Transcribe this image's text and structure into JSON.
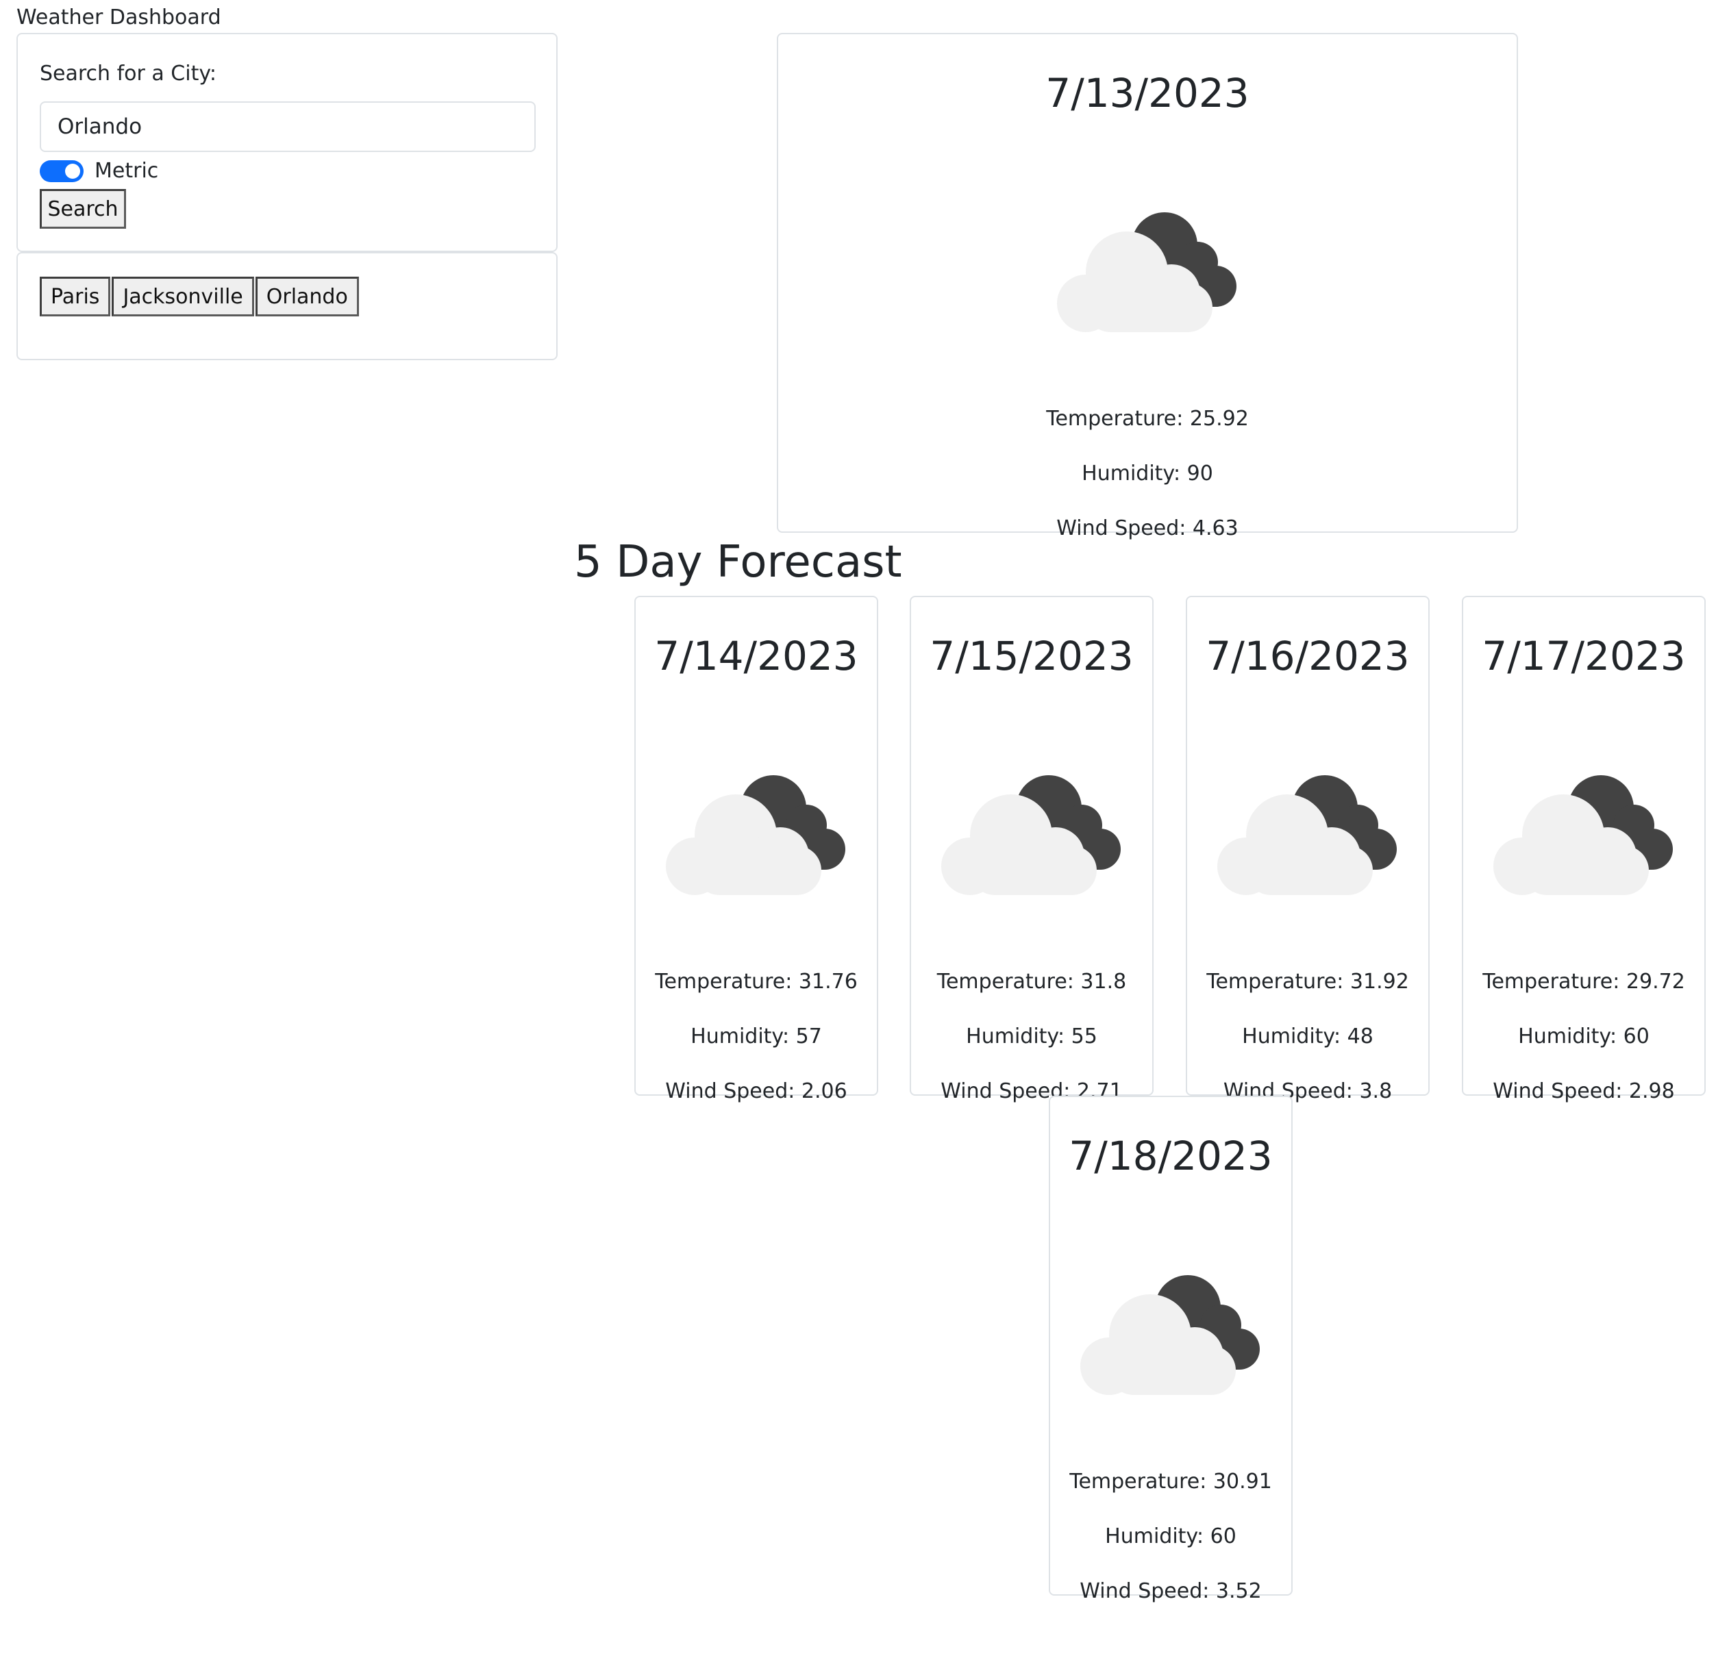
{
  "app": {
    "title": "Weather Dashboard"
  },
  "search": {
    "label": "Search for a City:",
    "value": "Orlando",
    "metric_label": "Metric",
    "metric_enabled": true,
    "search_button": "Search"
  },
  "history": [
    "Paris",
    "Jacksonville",
    "Orlando"
  ],
  "current": {
    "date": "7/13/2023",
    "icon": "broken-clouds-night-icon",
    "temperature": "Temperature: 25.92",
    "humidity": "Humidity: 90",
    "wind": "Wind Speed: 4.63"
  },
  "forecast": {
    "title": "5 Day Forecast",
    "days": [
      {
        "date": "7/14/2023",
        "icon": "broken-clouds-night-icon",
        "temperature": "Temperature: 31.76",
        "humidity": "Humidity: 57",
        "wind": "Wind Speed: 2.06"
      },
      {
        "date": "7/15/2023",
        "icon": "broken-clouds-night-icon",
        "temperature": "Temperature: 31.8",
        "humidity": "Humidity: 55",
        "wind": "Wind Speed: 2.71"
      },
      {
        "date": "7/16/2023",
        "icon": "broken-clouds-night-icon",
        "temperature": "Temperature: 31.92",
        "humidity": "Humidity: 48",
        "wind": "Wind Speed: 3.8"
      },
      {
        "date": "7/17/2023",
        "icon": "broken-clouds-night-icon",
        "temperature": "Temperature: 29.72",
        "humidity": "Humidity: 60",
        "wind": "Wind Speed: 2.98"
      },
      {
        "date": "7/18/2023",
        "icon": "broken-clouds-night-icon",
        "temperature": "Temperature: 30.91",
        "humidity": "Humidity: 60",
        "wind": "Wind Speed: 3.52"
      }
    ]
  },
  "colors": {
    "accent": "#0d6efd",
    "cloud_light": "#f1f1f1",
    "cloud_dark": "#434343"
  }
}
